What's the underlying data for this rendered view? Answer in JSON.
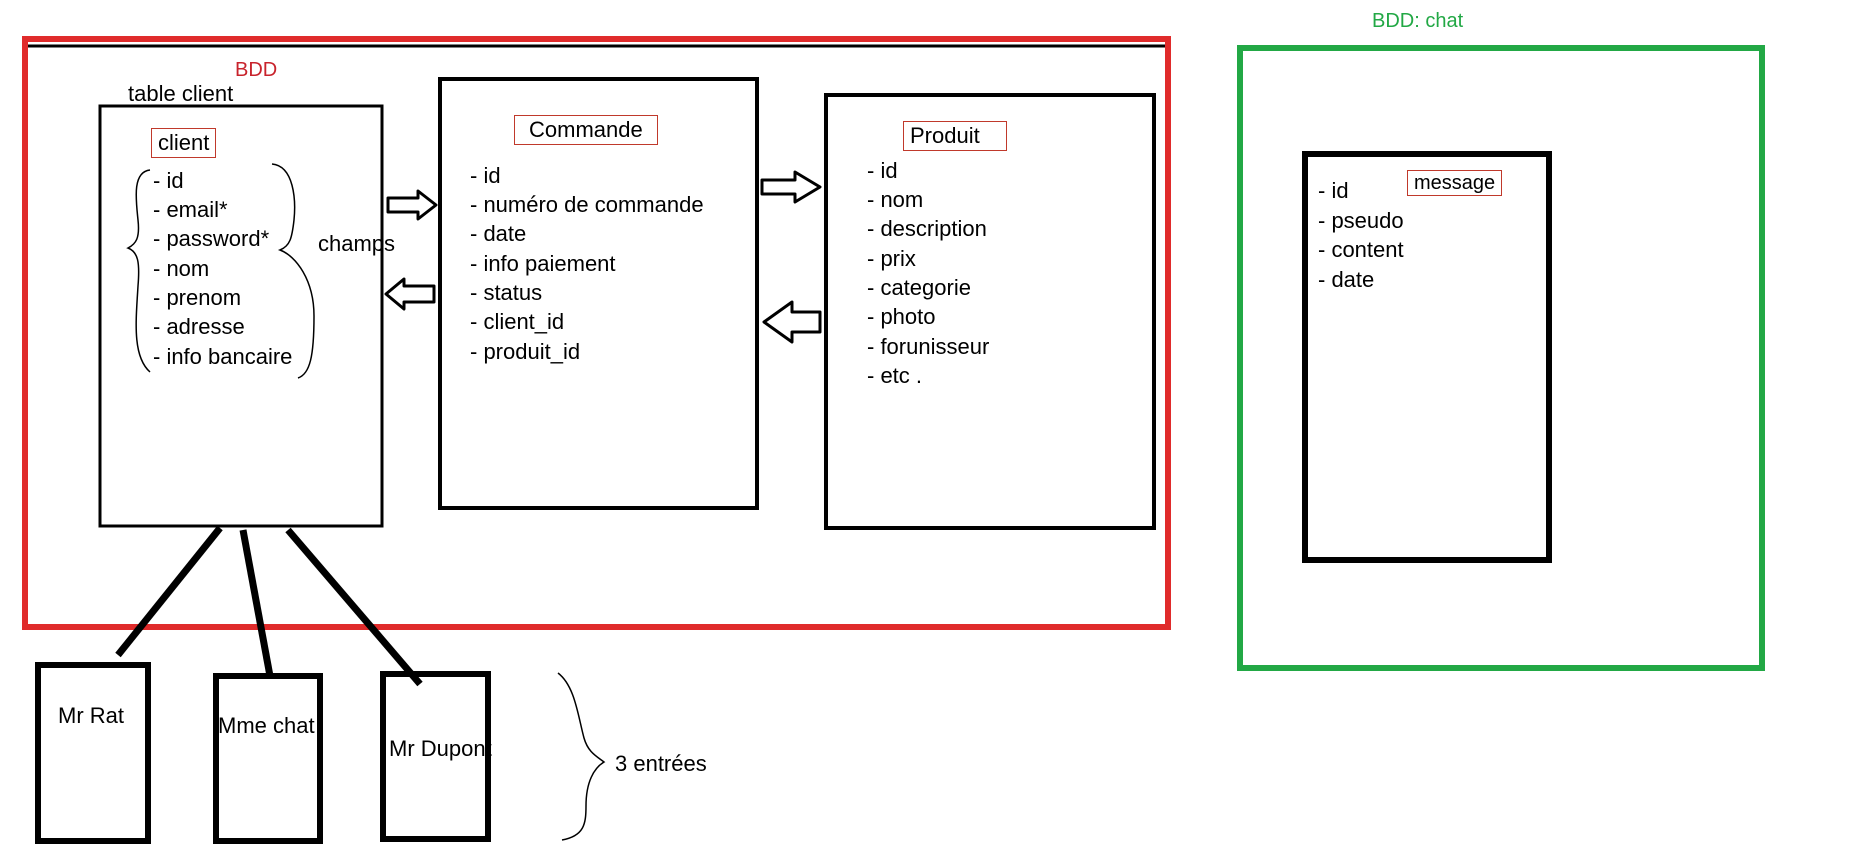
{
  "bdd_main": {
    "label": "BDD",
    "color": "#e02b2b"
  },
  "bdd_chat": {
    "label": "BDD: chat",
    "color": "#22a845"
  },
  "table_client_caption": "table client",
  "champs_label": "champs",
  "entries_label": "3 entrées",
  "tables": {
    "client": {
      "title": "client",
      "fields": [
        "- id",
        "- email*",
        "- password*",
        "- nom",
        "- prenom",
        "- adresse",
        "- info bancaire"
      ]
    },
    "commande": {
      "title": "Commande",
      "fields": [
        "- id",
        "- numéro de commande",
        "- date",
        "- info paiement",
        "- status",
        "- client_id",
        "- produit_id"
      ]
    },
    "produit": {
      "title": "Produit",
      "fields": [
        "- id",
        "- nom",
        "- description",
        "- prix",
        "- categorie",
        "- photo",
        "- forunisseur",
        "- etc ."
      ]
    },
    "message": {
      "title": "message",
      "fields": [
        "- id",
        "- pseudo",
        "-  content",
        "- date"
      ]
    }
  },
  "entries": [
    "Mr Rat",
    "Mme chat",
    "Mr Dupont"
  ]
}
